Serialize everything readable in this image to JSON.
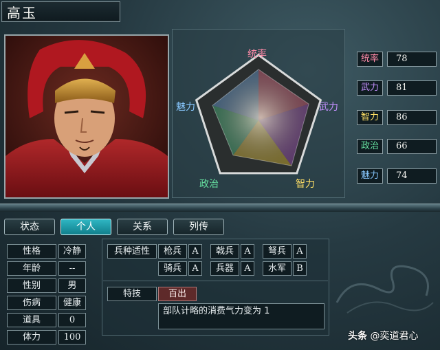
{
  "character": {
    "name": "高玉"
  },
  "radar": {
    "labels": {
      "top": "统率",
      "right": "武力",
      "bottom_right": "智力",
      "bottom_left": "政治",
      "left": "魅力"
    },
    "values": {
      "command": 78,
      "war": 81,
      "intelligence": 86,
      "politics": 66,
      "charm": 74
    },
    "colors": {
      "command": "#e06080",
      "war": "#a050c0",
      "intelligence": "#e0c030",
      "politics": "#40c080",
      "charm": "#60a0e0"
    }
  },
  "stats": [
    {
      "label": "统率",
      "value": "78",
      "color": "#ff8aa8"
    },
    {
      "label": "武力",
      "value": "81",
      "color": "#c490ff"
    },
    {
      "label": "智力",
      "value": "86",
      "color": "#ffe066"
    },
    {
      "label": "政治",
      "value": "66",
      "color": "#66e0a0"
    },
    {
      "label": "魅力",
      "value": "74",
      "color": "#88c8ff"
    }
  ],
  "tabs": [
    {
      "label": "状态",
      "active": false
    },
    {
      "label": "个人",
      "active": true
    },
    {
      "label": "关系",
      "active": false
    },
    {
      "label": "列传",
      "active": false
    }
  ],
  "attributes": [
    {
      "label": "性格",
      "value": "冷静"
    },
    {
      "label": "年龄",
      "value": "--"
    },
    {
      "label": "性别",
      "value": "男"
    },
    {
      "label": "伤病",
      "value": "健康"
    },
    {
      "label": "道具",
      "value": "0"
    },
    {
      "label": "体力",
      "value": "100"
    }
  ],
  "aptitude": {
    "header": "兵种适性",
    "units": [
      {
        "label": "枪兵",
        "grade": "A"
      },
      {
        "label": "戟兵",
        "grade": "A"
      },
      {
        "label": "弩兵",
        "grade": "A"
      },
      {
        "label": "骑兵",
        "grade": "A"
      },
      {
        "label": "兵器",
        "grade": "A"
      },
      {
        "label": "水军",
        "grade": "B"
      }
    ]
  },
  "skill": {
    "label": "特技",
    "value": "百出",
    "description": "部队计略的消费气力变为 1"
  },
  "watermark": {
    "brand": "头条",
    "handle": "@奕道君心"
  }
}
